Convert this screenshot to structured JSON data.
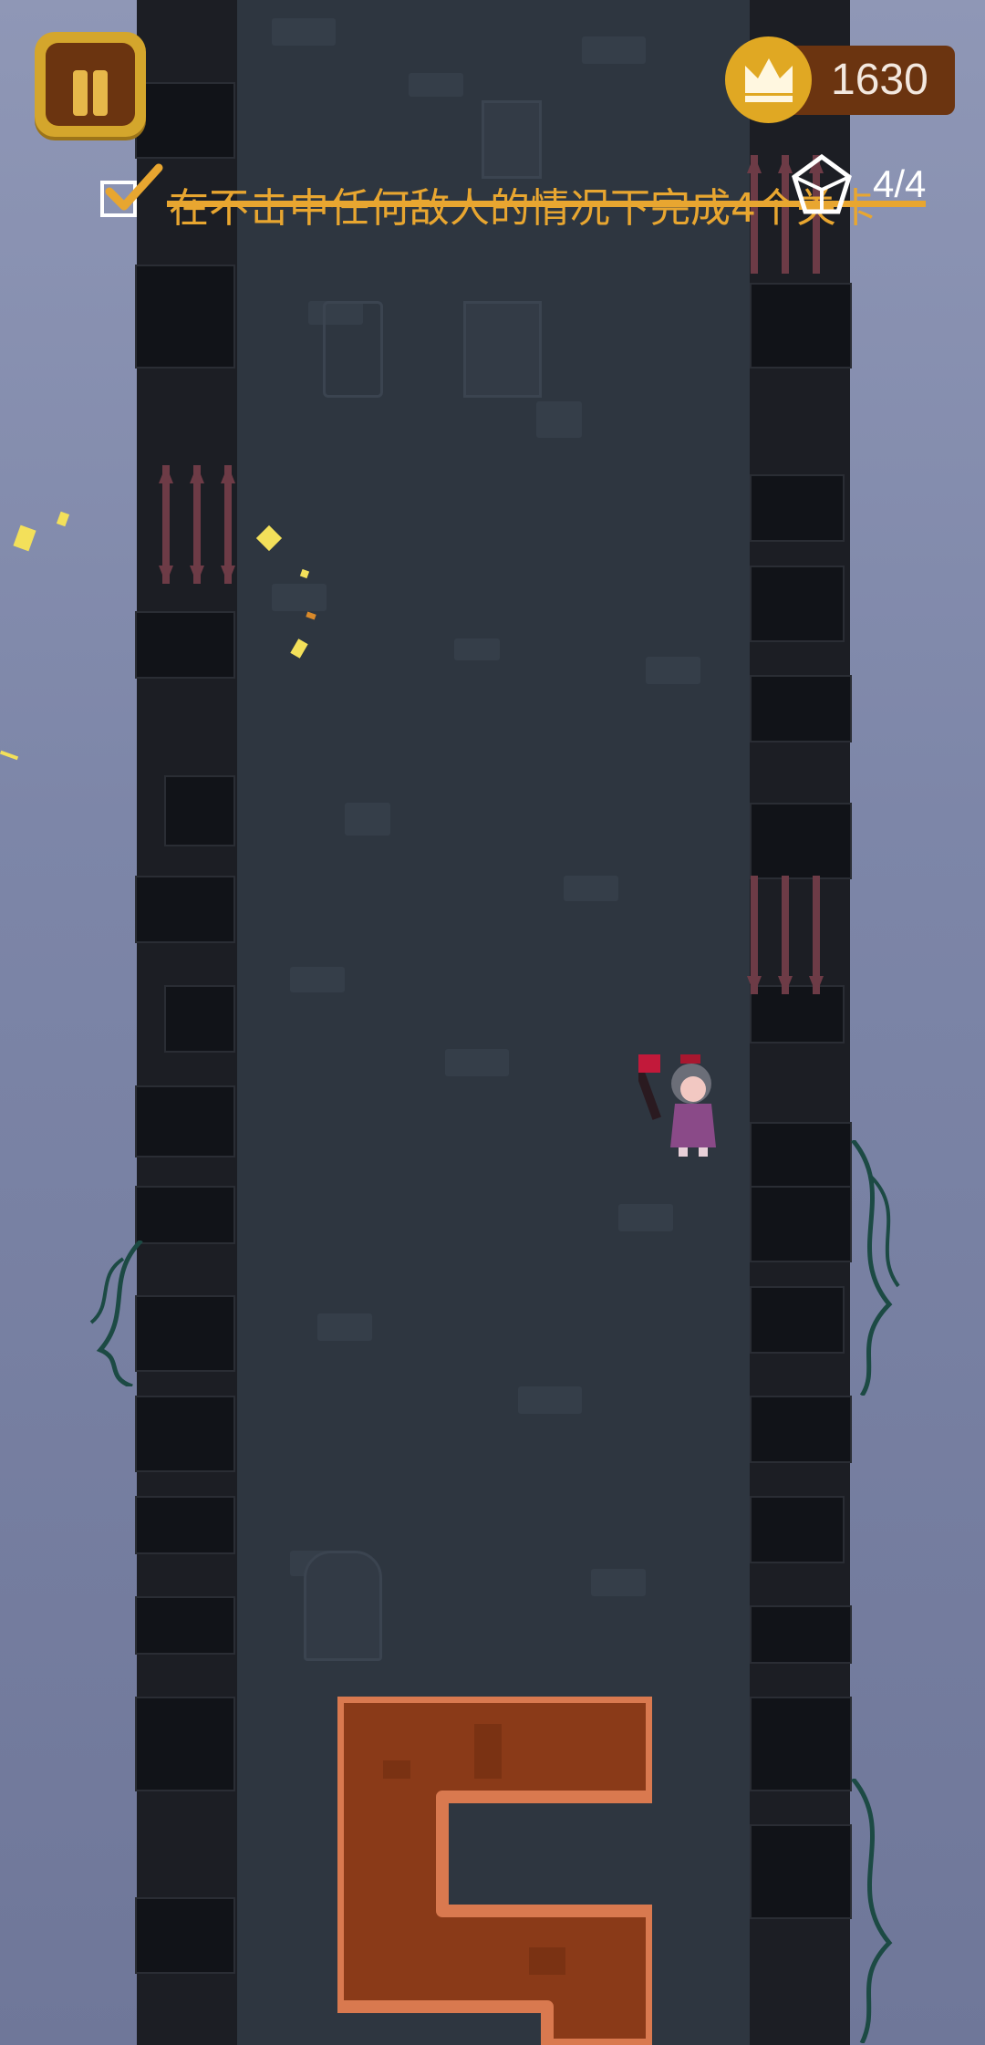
{
  "hud": {
    "pause_label": "",
    "score": "1630",
    "objective": {
      "text": "在不击中任何敌人的情况下完成4个关卡",
      "completed": true
    },
    "progress": {
      "current": "4",
      "separator": "/",
      "total": "4"
    }
  },
  "icons": {
    "pause": "pause-icon",
    "crown": "crown-icon",
    "check": "check-icon",
    "gem": "gem-icon"
  },
  "colors": {
    "sky": "#8f97b6",
    "tower_interior": "#2e3640",
    "wall": "#1c1e24",
    "accent_gold": "#e0a823",
    "panel_brown": "#6b3410",
    "objective_text": "#e8a630",
    "block_fill": "#8a3a18",
    "block_edge": "#d9794f"
  }
}
